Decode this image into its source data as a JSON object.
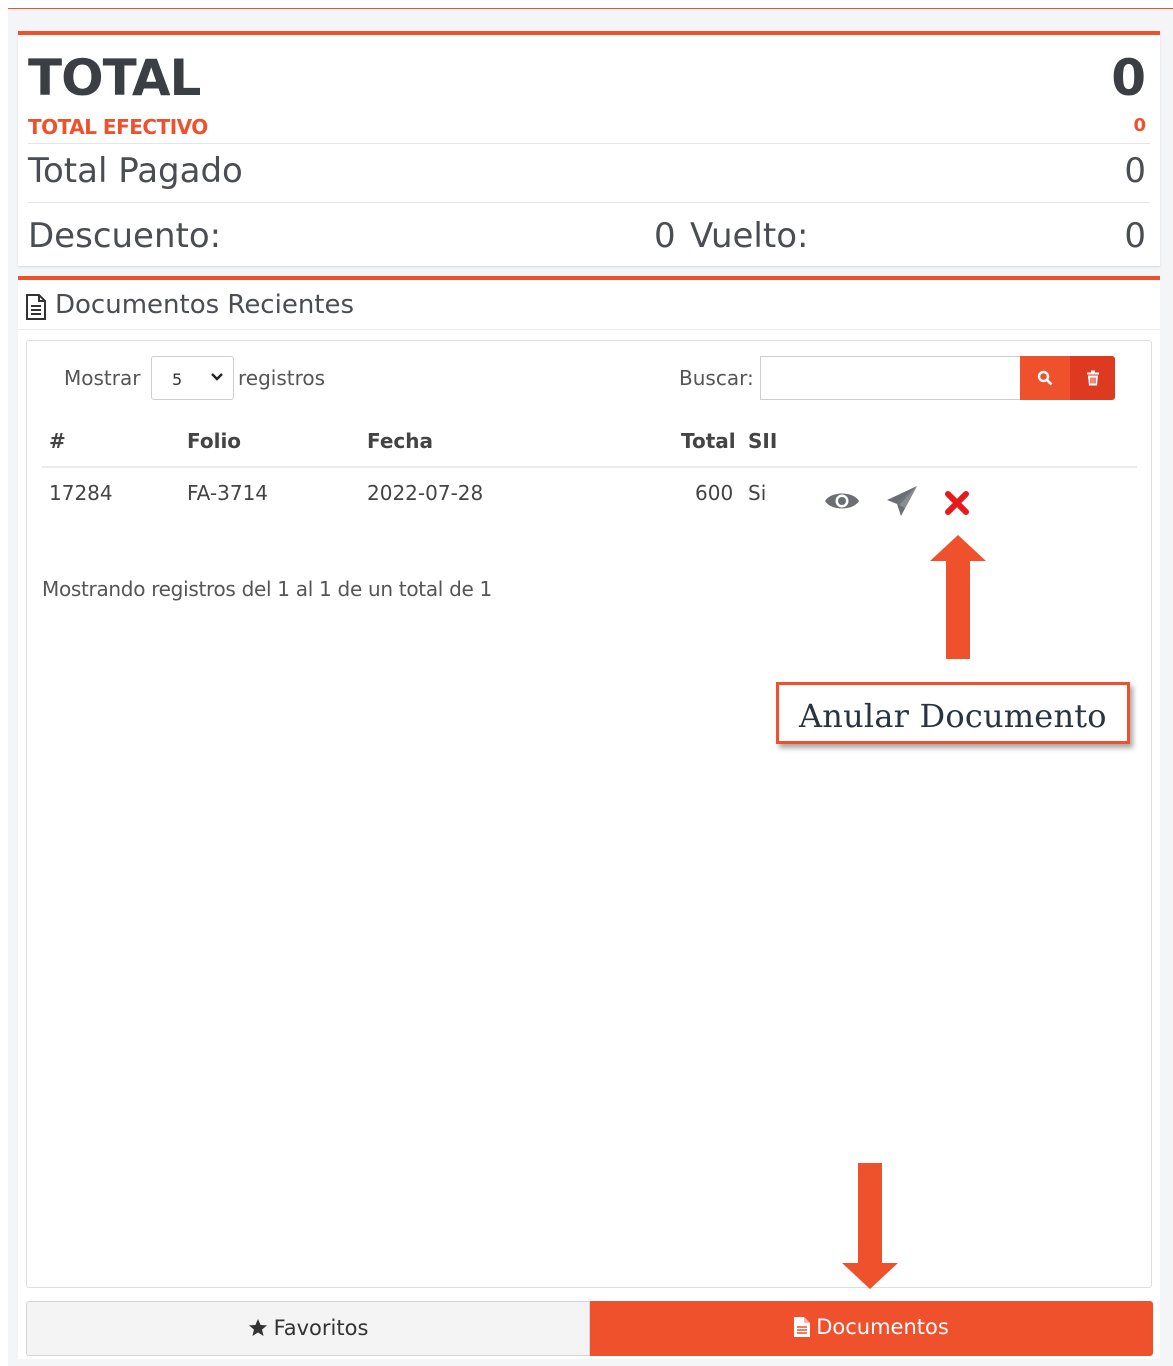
{
  "totals": {
    "total_label": "TOTAL",
    "total_value": "0",
    "efectivo_label": "TOTAL EFECTIVO",
    "efectivo_value": "0",
    "pagado_label": "Total Pagado",
    "pagado_value": "0",
    "descuento_label": "Descuento:",
    "descuento_value": "0",
    "vuelto_label": "Vuelto:",
    "vuelto_value": "0"
  },
  "documents": {
    "title": "Documentos Recientes",
    "title_icon": "document-icon",
    "length": {
      "prefix": "Mostrar",
      "selected": "5",
      "suffix": "registros"
    },
    "search": {
      "label": "Buscar:",
      "value": "",
      "search_icon": "search-icon",
      "clear_icon": "trash-icon"
    },
    "columns": [
      "#",
      "Folio",
      "Fecha",
      "Total",
      "SII"
    ],
    "rows": [
      {
        "id": "17284",
        "folio": "FA-3714",
        "fecha": "2022-07-28",
        "total": "600",
        "sii": "Si",
        "actions": [
          "eye-icon",
          "paper-plane-icon",
          "close-icon"
        ]
      }
    ],
    "info": "Mostrando registros del 1 al 1 de un total de 1"
  },
  "annotation": {
    "callout": "Anular Documento"
  },
  "tabs": [
    {
      "label": "Favoritos",
      "icon": "star-icon",
      "active": false
    },
    {
      "label": "Documentos",
      "icon": "file-icon",
      "active": true
    }
  ],
  "colors": {
    "accent": "#f0512d",
    "danger": "#e8191b",
    "clear_button": "#de3a22"
  }
}
